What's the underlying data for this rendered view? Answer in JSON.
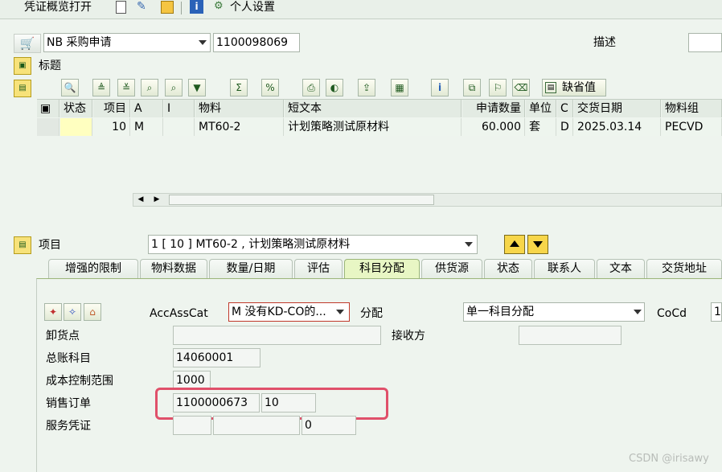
{
  "menu": {
    "overview_label": "凭证概览打开",
    "personal_settings_label": "个人设置"
  },
  "header": {
    "doc_type_value": "NB 采购申请",
    "doc_number_value": "1100098069",
    "description_label": "描述",
    "title_label": "标题"
  },
  "grid_toolbar": {
    "default_values_label": "缺省值"
  },
  "grid": {
    "columns": {
      "status": "状态",
      "item": "项目",
      "a": "A",
      "i": "I",
      "material": "物料",
      "short_text": "短文本",
      "qty": "申请数量",
      "unit": "单位",
      "c": "C",
      "delivery_date": "交货日期",
      "material_group": "物料组"
    },
    "row": {
      "status": "",
      "item": "10",
      "a": "M",
      "i": "",
      "material": "MT60-2",
      "short_text": "计划策略测试原材料",
      "qty": "60.000",
      "unit": "套",
      "c": "D",
      "delivery_date": "2025.03.14",
      "material_group": "PECVD"
    }
  },
  "item_detail": {
    "label": "项目",
    "selected_value": "1 [ 10 ] MT60-2 , 计划策略测试原材料"
  },
  "tabs": [
    "增强的限制",
    "物料数据",
    "数量/日期",
    "评估",
    "科目分配",
    "供货源",
    "状态",
    "联系人",
    "文本",
    "交货地址"
  ],
  "active_tab": "科目分配",
  "account_assignment": {
    "acc_cat_label": "AccAssCat",
    "acc_cat_value": "M 没有KD-CO的...",
    "distribution_label": "分配",
    "distribution_value": "单一科目分配",
    "coco_label": "CoCd",
    "coco_value": "1",
    "unloading_point_label": "卸货点",
    "unloading_point_value": "",
    "recipient_label": "接收方",
    "recipient_value": "",
    "gl_account_label": "总账科目",
    "gl_account_value": "14060001",
    "co_area_label": "成本控制范围",
    "co_area_value": "1000",
    "sales_order_label": "销售订单",
    "sales_order_value": "1100000673",
    "sales_order_item_value": "10",
    "service_doc_label": "服务凭证",
    "service_doc_value": "",
    "service_doc_field2_value": "",
    "service_doc_field3_value": "0"
  },
  "watermark": "CSDN @irisawy",
  "colors": {
    "background": "#eef4ee",
    "highlight_box": "#e0506a",
    "active_tab": "#e8f6c4",
    "status_cell": "#ffffc0"
  }
}
